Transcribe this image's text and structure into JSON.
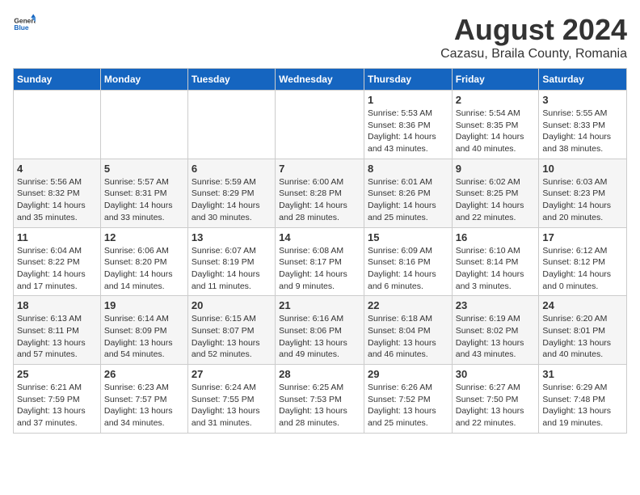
{
  "header": {
    "logo_general": "General",
    "logo_blue": "Blue",
    "title": "August 2024",
    "subtitle": "Cazasu, Braila County, Romania"
  },
  "days_of_week": [
    "Sunday",
    "Monday",
    "Tuesday",
    "Wednesday",
    "Thursday",
    "Friday",
    "Saturday"
  ],
  "weeks": [
    [
      {
        "day": "",
        "info": ""
      },
      {
        "day": "",
        "info": ""
      },
      {
        "day": "",
        "info": ""
      },
      {
        "day": "",
        "info": ""
      },
      {
        "day": "1",
        "info": "Sunrise: 5:53 AM\nSunset: 8:36 PM\nDaylight: 14 hours\nand 43 minutes."
      },
      {
        "day": "2",
        "info": "Sunrise: 5:54 AM\nSunset: 8:35 PM\nDaylight: 14 hours\nand 40 minutes."
      },
      {
        "day": "3",
        "info": "Sunrise: 5:55 AM\nSunset: 8:33 PM\nDaylight: 14 hours\nand 38 minutes."
      }
    ],
    [
      {
        "day": "4",
        "info": "Sunrise: 5:56 AM\nSunset: 8:32 PM\nDaylight: 14 hours\nand 35 minutes."
      },
      {
        "day": "5",
        "info": "Sunrise: 5:57 AM\nSunset: 8:31 PM\nDaylight: 14 hours\nand 33 minutes."
      },
      {
        "day": "6",
        "info": "Sunrise: 5:59 AM\nSunset: 8:29 PM\nDaylight: 14 hours\nand 30 minutes."
      },
      {
        "day": "7",
        "info": "Sunrise: 6:00 AM\nSunset: 8:28 PM\nDaylight: 14 hours\nand 28 minutes."
      },
      {
        "day": "8",
        "info": "Sunrise: 6:01 AM\nSunset: 8:26 PM\nDaylight: 14 hours\nand 25 minutes."
      },
      {
        "day": "9",
        "info": "Sunrise: 6:02 AM\nSunset: 8:25 PM\nDaylight: 14 hours\nand 22 minutes."
      },
      {
        "day": "10",
        "info": "Sunrise: 6:03 AM\nSunset: 8:23 PM\nDaylight: 14 hours\nand 20 minutes."
      }
    ],
    [
      {
        "day": "11",
        "info": "Sunrise: 6:04 AM\nSunset: 8:22 PM\nDaylight: 14 hours\nand 17 minutes."
      },
      {
        "day": "12",
        "info": "Sunrise: 6:06 AM\nSunset: 8:20 PM\nDaylight: 14 hours\nand 14 minutes."
      },
      {
        "day": "13",
        "info": "Sunrise: 6:07 AM\nSunset: 8:19 PM\nDaylight: 14 hours\nand 11 minutes."
      },
      {
        "day": "14",
        "info": "Sunrise: 6:08 AM\nSunset: 8:17 PM\nDaylight: 14 hours\nand 9 minutes."
      },
      {
        "day": "15",
        "info": "Sunrise: 6:09 AM\nSunset: 8:16 PM\nDaylight: 14 hours\nand 6 minutes."
      },
      {
        "day": "16",
        "info": "Sunrise: 6:10 AM\nSunset: 8:14 PM\nDaylight: 14 hours\nand 3 minutes."
      },
      {
        "day": "17",
        "info": "Sunrise: 6:12 AM\nSunset: 8:12 PM\nDaylight: 14 hours\nand 0 minutes."
      }
    ],
    [
      {
        "day": "18",
        "info": "Sunrise: 6:13 AM\nSunset: 8:11 PM\nDaylight: 13 hours\nand 57 minutes."
      },
      {
        "day": "19",
        "info": "Sunrise: 6:14 AM\nSunset: 8:09 PM\nDaylight: 13 hours\nand 54 minutes."
      },
      {
        "day": "20",
        "info": "Sunrise: 6:15 AM\nSunset: 8:07 PM\nDaylight: 13 hours\nand 52 minutes."
      },
      {
        "day": "21",
        "info": "Sunrise: 6:16 AM\nSunset: 8:06 PM\nDaylight: 13 hours\nand 49 minutes."
      },
      {
        "day": "22",
        "info": "Sunrise: 6:18 AM\nSunset: 8:04 PM\nDaylight: 13 hours\nand 46 minutes."
      },
      {
        "day": "23",
        "info": "Sunrise: 6:19 AM\nSunset: 8:02 PM\nDaylight: 13 hours\nand 43 minutes."
      },
      {
        "day": "24",
        "info": "Sunrise: 6:20 AM\nSunset: 8:01 PM\nDaylight: 13 hours\nand 40 minutes."
      }
    ],
    [
      {
        "day": "25",
        "info": "Sunrise: 6:21 AM\nSunset: 7:59 PM\nDaylight: 13 hours\nand 37 minutes."
      },
      {
        "day": "26",
        "info": "Sunrise: 6:23 AM\nSunset: 7:57 PM\nDaylight: 13 hours\nand 34 minutes."
      },
      {
        "day": "27",
        "info": "Sunrise: 6:24 AM\nSunset: 7:55 PM\nDaylight: 13 hours\nand 31 minutes."
      },
      {
        "day": "28",
        "info": "Sunrise: 6:25 AM\nSunset: 7:53 PM\nDaylight: 13 hours\nand 28 minutes."
      },
      {
        "day": "29",
        "info": "Sunrise: 6:26 AM\nSunset: 7:52 PM\nDaylight: 13 hours\nand 25 minutes."
      },
      {
        "day": "30",
        "info": "Sunrise: 6:27 AM\nSunset: 7:50 PM\nDaylight: 13 hours\nand 22 minutes."
      },
      {
        "day": "31",
        "info": "Sunrise: 6:29 AM\nSunset: 7:48 PM\nDaylight: 13 hours\nand 19 minutes."
      }
    ]
  ]
}
